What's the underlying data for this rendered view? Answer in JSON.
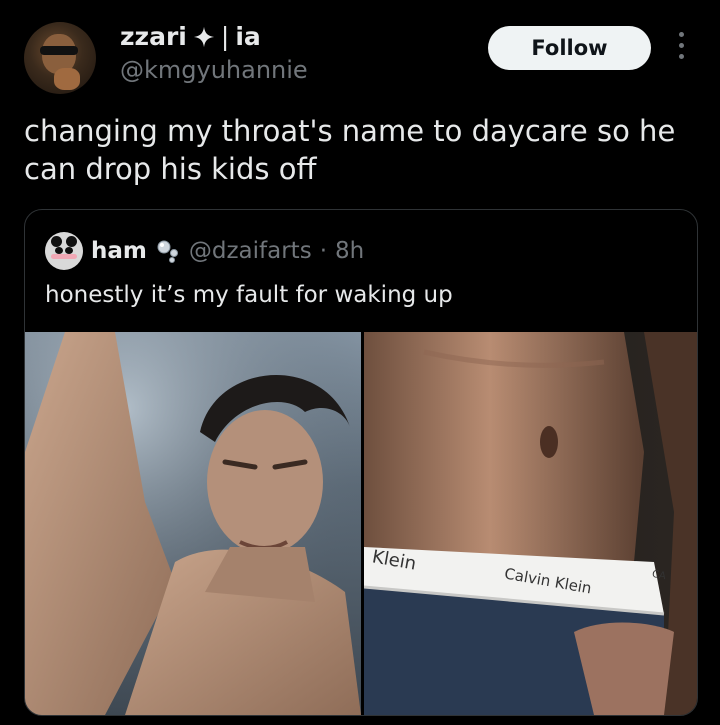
{
  "author": {
    "display_name": "zzari",
    "name_suffix": "ia",
    "separator": "|",
    "handle": "@kmgyuhannie",
    "badge_icon": "sparkle-icon"
  },
  "follow_button": {
    "label": "Follow"
  },
  "more_icon": "more-vertical-icon",
  "tweet": {
    "text": "changing my throat's name to daycare so he can drop his kids off"
  },
  "quoted": {
    "display_name": "ham",
    "badge_icon": "bubble-icon",
    "handle": "@dzaifarts",
    "dot": "·",
    "time": "8h",
    "text": "honestly it’s my fault for waking up",
    "images": [
      {
        "name": "shirtless-man-photo"
      },
      {
        "name": "calvin-klein-waistband-photo",
        "brand_text_left": "Klein",
        "brand_text_band": "Calvin Klein",
        "brand_text_edge": "CA"
      }
    ]
  },
  "colors": {
    "background": "#000000",
    "text": "#e7e9ea",
    "muted": "#71767b",
    "border": "#2f3336",
    "follow_bg": "#eff3f4"
  }
}
